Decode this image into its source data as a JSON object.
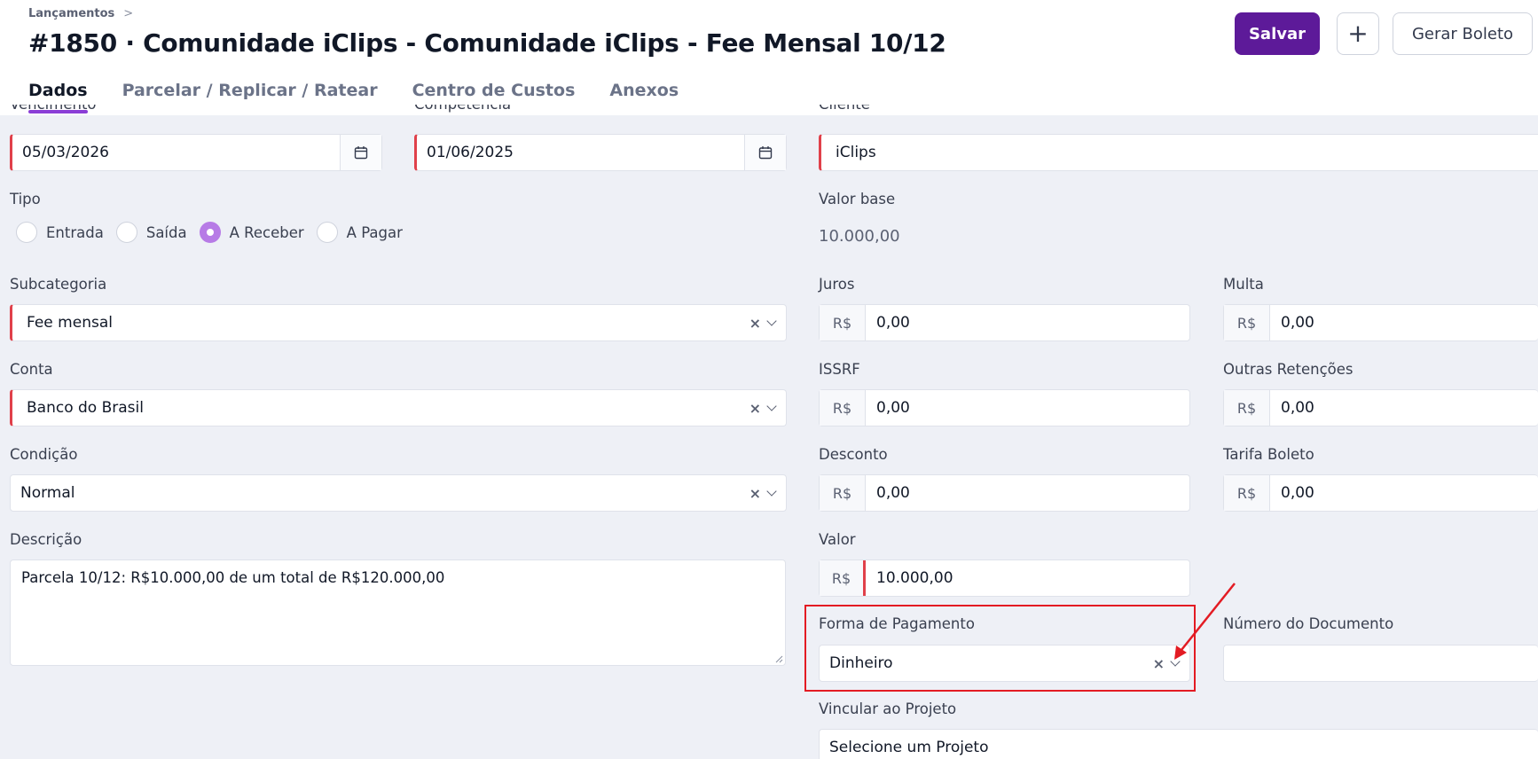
{
  "header": {
    "breadcrumb": "Lançamentos",
    "breadcrumb_sep": ">",
    "title": "#1850 · Comunidade iClips - Comunidade iClips - Fee Mensal 10/12",
    "save_label": "Salvar",
    "add_label": "+",
    "boleto_label": "Gerar Boleto"
  },
  "tabs": [
    {
      "label": "Dados",
      "active": true
    },
    {
      "label": "Parcelar / Replicar / Ratear",
      "active": false
    },
    {
      "label": "Centro de Custos",
      "active": false
    },
    {
      "label": "Anexos",
      "active": false
    }
  ],
  "form": {
    "vencimento": {
      "label": "Vencimento",
      "value": "05/03/2026"
    },
    "competencia": {
      "label": "Competência",
      "value": "01/06/2025"
    },
    "cliente": {
      "label": "Cliente",
      "value": "iClips"
    },
    "tipo": {
      "label": "Tipo",
      "options": [
        "Entrada",
        "Saída",
        "A Receber",
        "A Pagar"
      ],
      "selected": "A Receber"
    },
    "valor_base": {
      "label": "Valor base",
      "value": "10.000,00"
    },
    "subcategoria": {
      "label": "Subcategoria",
      "value": "Fee mensal"
    },
    "conta": {
      "label": "Conta",
      "value": "Banco do Brasil"
    },
    "condicao": {
      "label": "Condição",
      "value": "Normal"
    },
    "descricao": {
      "label": "Descrição",
      "value": "Parcela 10/12: R$10.000,00 de um total de R$120.000,00"
    },
    "currency": "R$",
    "juros": {
      "label": "Juros",
      "value": "0,00"
    },
    "multa": {
      "label": "Multa",
      "value": "0,00"
    },
    "issrf": {
      "label": "ISSRF",
      "value": "0,00"
    },
    "outras_retencoes": {
      "label": "Outras Retenções",
      "value": "0,00"
    },
    "desconto": {
      "label": "Desconto",
      "value": "0,00"
    },
    "tarifa_boleto": {
      "label": "Tarifa Boleto",
      "value": "0,00"
    },
    "valor": {
      "label": "Valor",
      "value": "10.000,00"
    },
    "forma_pagamento": {
      "label": "Forma de Pagamento",
      "value": "Dinheiro"
    },
    "numero_documento": {
      "label": "Número do Documento",
      "value": ""
    },
    "projeto": {
      "label": "Vincular ao Projeto",
      "value": "Selecione um Projeto"
    }
  },
  "icons": {
    "calendar": "calendar-icon",
    "clear": "×",
    "dropdown": "chevron-down-icon"
  },
  "colors": {
    "primary": "#5d1a99",
    "accent": "#8b3ed6",
    "required": "#e0404a",
    "annotation": "#e31b23"
  }
}
